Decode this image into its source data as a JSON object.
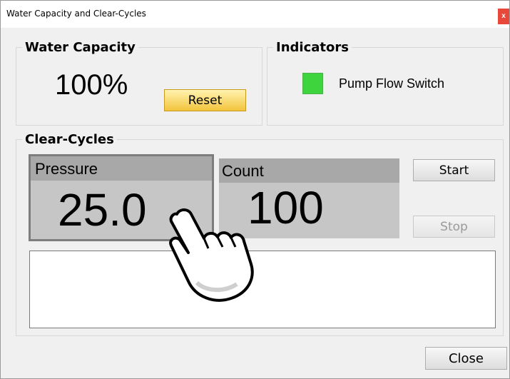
{
  "window": {
    "title": "Water Capacity and Clear-Cycles",
    "close_glyph": "x"
  },
  "water_capacity": {
    "label": "Water Capacity",
    "value": "100%",
    "reset_label": "Reset"
  },
  "indicators": {
    "label": "Indicators",
    "pump_flow_switch": "Pump Flow Switch",
    "pump_led_color": "#3ed43e"
  },
  "clear_cycles": {
    "label": "Clear-Cycles",
    "pressure_label": "Pressure",
    "pressure_value": "25.0",
    "count_label": "Count",
    "count_value": "100",
    "start_label": "Start",
    "stop_label": "Stop",
    "log_text": ""
  },
  "footer": {
    "close_label": "Close"
  },
  "overlay": {
    "cursor_icon": "hand-pointer-icon"
  }
}
